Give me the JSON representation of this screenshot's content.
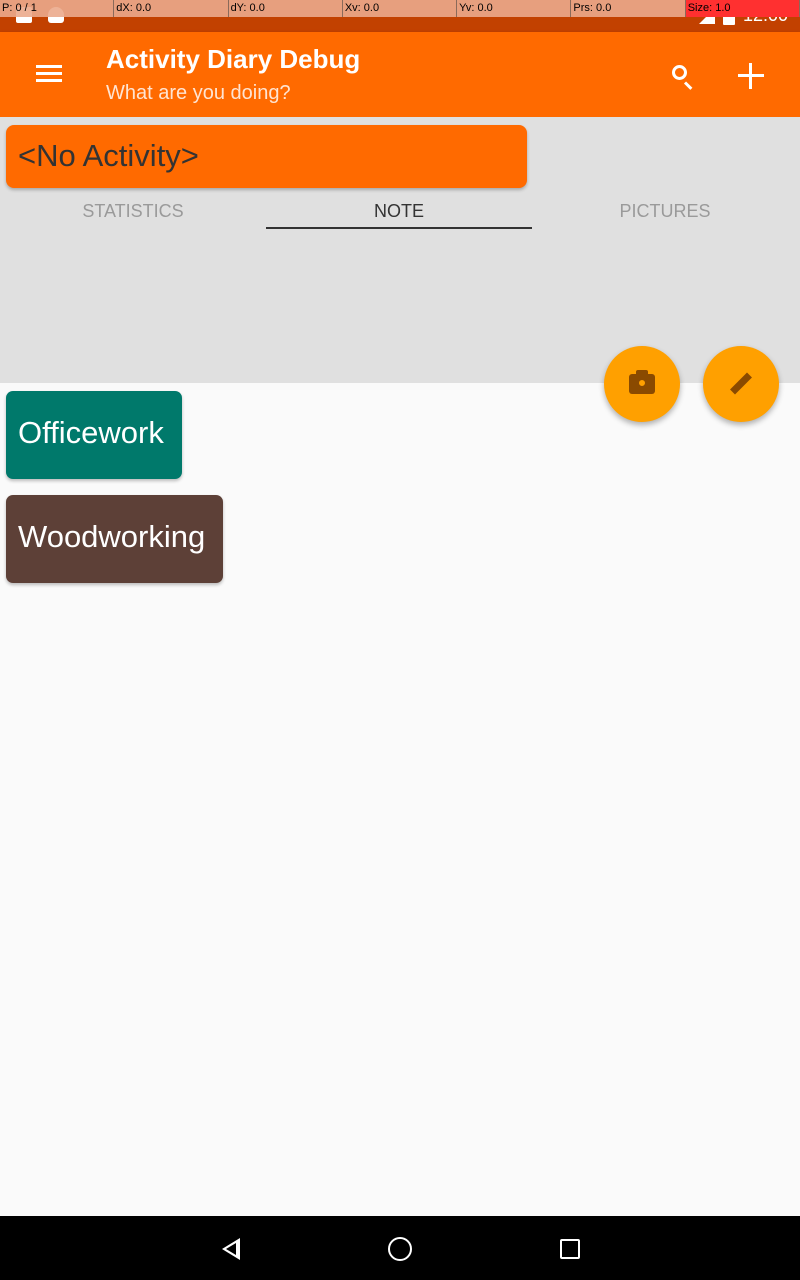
{
  "status_bar": {
    "time": "12:00"
  },
  "debug_overlay": {
    "cells": [
      "P: 0 / 1",
      "dX: 0.0",
      "dY: 0.0",
      "Xv: 0.0",
      "Yv: 0.0",
      "Prs: 0.0",
      "Size: 1.0"
    ]
  },
  "app_bar": {
    "title": "Activity Diary Debug",
    "subtitle": "What are you doing?",
    "icons": [
      "menu-icon",
      "search-icon",
      "add-icon"
    ]
  },
  "current_activity": {
    "label": "<No Activity>"
  },
  "tabs": [
    {
      "label": "STATISTICS",
      "selected": false
    },
    {
      "label": "NOTE",
      "selected": true
    },
    {
      "label": "PICTURES",
      "selected": false
    }
  ],
  "fabs": {
    "camera": "camera-icon",
    "edit": "edit-icon"
  },
  "activities": [
    {
      "label": "Officework",
      "color": "#00796b"
    },
    {
      "label": "Woodworking",
      "color": "#5d4037"
    }
  ],
  "colors": {
    "primary": "#ff6a00",
    "accent": "#ffa000",
    "status_bar": "#c24100"
  }
}
